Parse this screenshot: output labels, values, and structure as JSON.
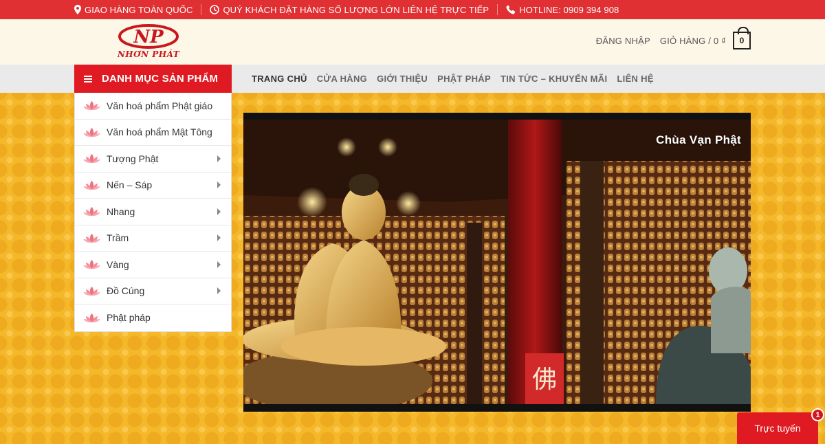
{
  "topbar": {
    "items": [
      {
        "icon": "map-pin-icon",
        "label": "GIAO HÀNG TOÀN QUỐC"
      },
      {
        "icon": "clock-icon",
        "label": "QUÝ KHÁCH ĐẶT HÀNG SỐ LƯỢNG LỚN LIÊN HỆ TRỰC TIẾP"
      },
      {
        "icon": "phone-icon",
        "label": "HOTLINE: 0909 394 908"
      }
    ]
  },
  "header": {
    "logo_text": "NHƠN PHÁT",
    "logo_monogram": "NP",
    "login_label": "ĐĂNG NHẬP",
    "cart_label": "GIỎ HÀNG / 0 ₫",
    "cart_count": "0"
  },
  "nav": {
    "category_heading": "DANH MỤC SẢN PHẨM",
    "links": [
      "TRANG CHỦ",
      "CỬA HÀNG",
      "GIỚI THIỆU",
      "PHẬT PHÁP",
      "TIN TỨC – KHUYẾN MÃI",
      "LIÊN HỆ"
    ]
  },
  "categories": [
    {
      "label": "Văn hoá phẩm Phật giáo",
      "has_submenu": false
    },
    {
      "label": "Văn hoá phẩm Mật Tông",
      "has_submenu": false
    },
    {
      "label": "Tượng Phật",
      "has_submenu": true
    },
    {
      "label": "Nến – Sáp",
      "has_submenu": true
    },
    {
      "label": "Nhang",
      "has_submenu": true
    },
    {
      "label": "Trầm",
      "has_submenu": true
    },
    {
      "label": "Vàng",
      "has_submenu": true
    },
    {
      "label": "Đồ Cúng",
      "has_submenu": true
    },
    {
      "label": "Phật pháp",
      "has_submenu": false
    }
  ],
  "video": {
    "title": "Chùa Vạn Phật",
    "calligraphy": "佛"
  },
  "chat": {
    "label": "Trực tuyến",
    "badge": "1"
  },
  "colors": {
    "brand_red": "#e01a22",
    "topbar_red": "#e03033",
    "background_yellow": "#f4b82a",
    "header_cream": "#fdf7e8"
  }
}
